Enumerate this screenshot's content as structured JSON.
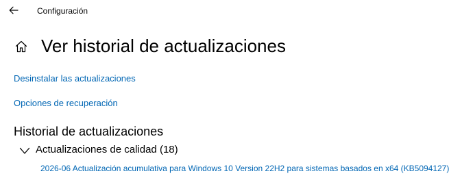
{
  "window": {
    "title": "Configuración"
  },
  "page": {
    "title": "Ver historial de actualizaciones"
  },
  "links": {
    "uninstall": "Desinstalar las actualizaciones",
    "recovery": "Opciones de recuperación"
  },
  "history": {
    "heading": "Historial de actualizaciones",
    "categories": [
      {
        "label": "Actualizaciones de calidad (18)",
        "expanded": true,
        "items": [
          "2026-06 Actualización acumulativa para Windows 10 Version 22H2 para sistemas basados en x64 (KB5094127)"
        ]
      }
    ]
  },
  "icons": {
    "back": "back-arrow-icon",
    "home": "home-icon",
    "expand": "chevron-down-icon"
  },
  "colors": {
    "link": "#0066b4",
    "text": "#000000",
    "background": "#ffffff"
  }
}
